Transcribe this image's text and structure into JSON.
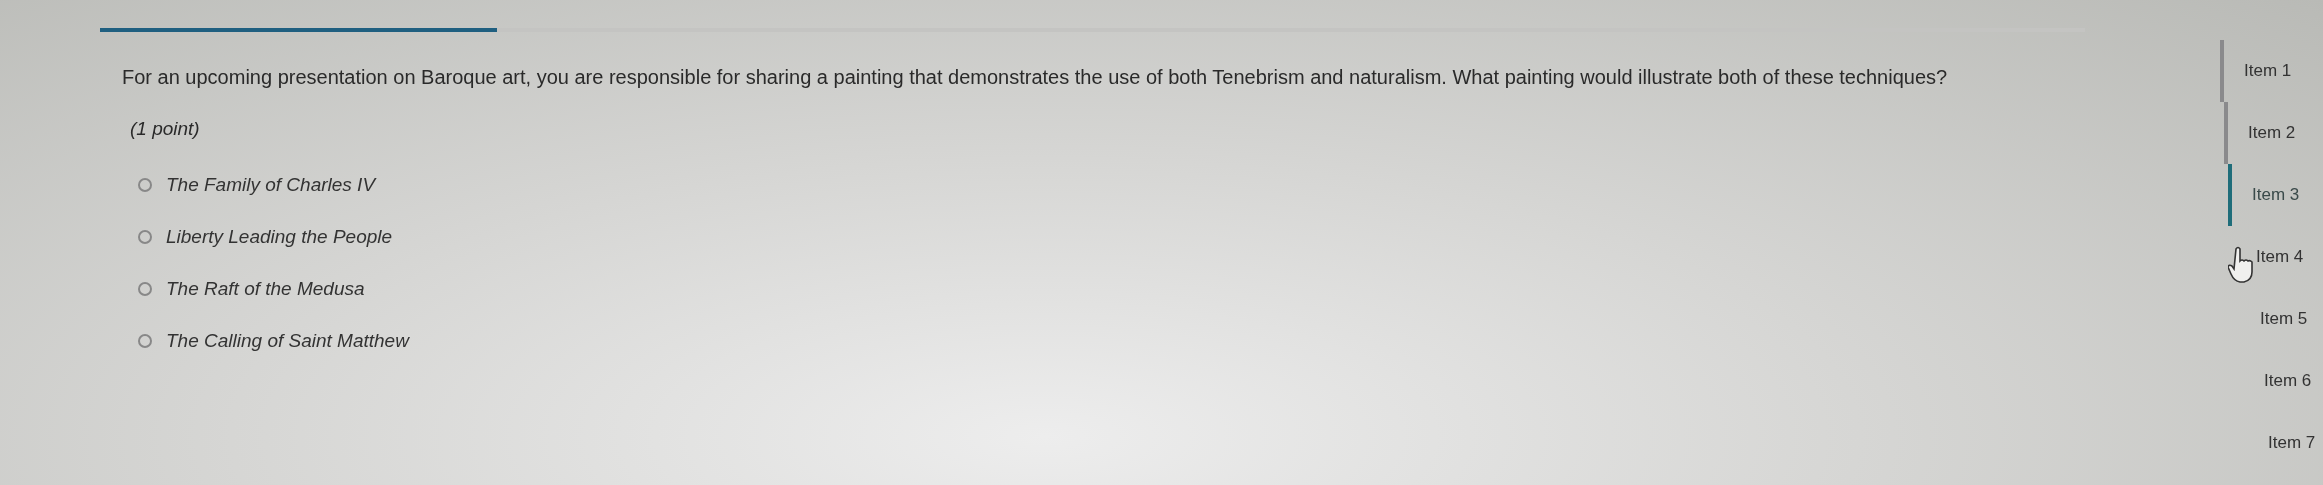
{
  "progress": {
    "level": 0.2
  },
  "question": {
    "text": "For an upcoming presentation on Baroque art, you are responsible for sharing a painting that demonstrates the use of both Tenebrism and naturalism. What painting would illustrate both of these techniques?",
    "points": "(1 point)"
  },
  "options": [
    {
      "label": "The Family of Charles IV",
      "selected": false
    },
    {
      "label": "Liberty Leading the People",
      "selected": false
    },
    {
      "label": "The Raft of the Medusa",
      "selected": false
    },
    {
      "label": "The Calling of Saint Matthew",
      "selected": false
    }
  ],
  "nav": {
    "items": [
      {
        "label": "Item 1",
        "visited": true,
        "selected": false
      },
      {
        "label": "Item 2",
        "visited": true,
        "selected": false
      },
      {
        "label": "Item 3",
        "visited": false,
        "selected": true
      },
      {
        "label": "Item 4",
        "visited": false,
        "selected": false
      },
      {
        "label": "Item 5",
        "visited": false,
        "selected": false
      },
      {
        "label": "Item 6",
        "visited": false,
        "selected": false
      },
      {
        "label": "Item 7",
        "visited": false,
        "selected": false
      }
    ]
  }
}
